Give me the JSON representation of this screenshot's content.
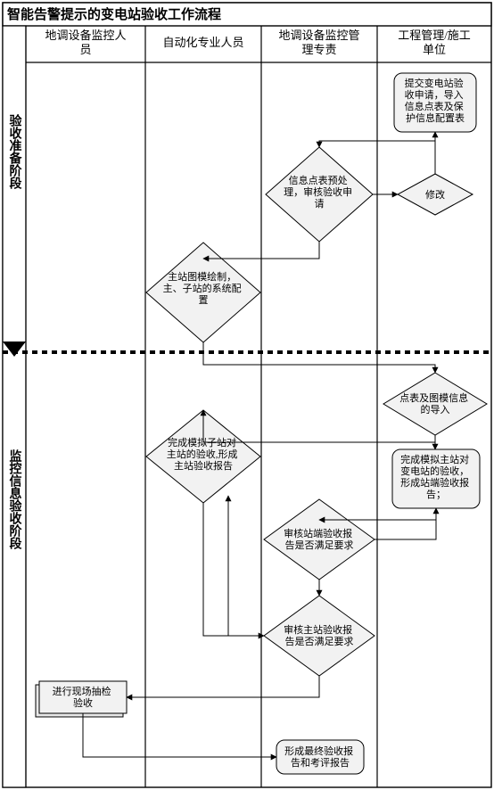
{
  "title": "智能告警提示的变电站验收工作流程",
  "phases": [
    "验收准备阶段",
    "监控信息验收阶段"
  ],
  "lanes": [
    "地调设备监控人员",
    "自动化专业人员",
    "地调设备监控管理专责",
    "工程管理/施工单位"
  ],
  "nodes": {
    "n1": "提交变电站验收申请，导入信息点表及保护信息配置表",
    "n2": "信息点表预处理，审核验收申请",
    "n3": "修改",
    "n4": "主站图模绘制，主、子站的系统配置",
    "n5": "点表及图模信息的导入",
    "n6": "完成模拟子站对主站的验收,形成主站验收报告",
    "n7": "完成模拟主站对变电站的验收，形成站端验收报告；",
    "n8": "审核站端验收报告是否满足要求",
    "n9": "审核主站验收报告是否满足要求",
    "n10": "进行现场抽检验收",
    "n11": "形成最终验收报告和考评报告"
  }
}
